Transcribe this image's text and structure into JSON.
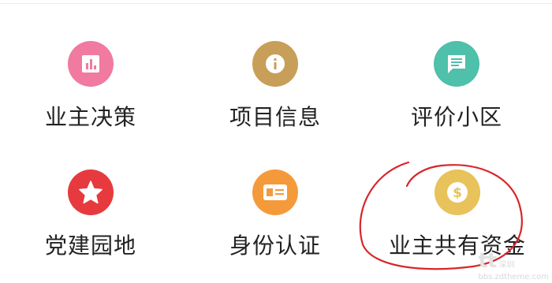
{
  "tiles": [
    {
      "label": "业主决策",
      "icon": "bar-chart-icon",
      "color": "#f07aa0"
    },
    {
      "label": "项目信息",
      "icon": "info-icon",
      "color": "#c79f59"
    },
    {
      "label": "评价小区",
      "icon": "chat-bubble-icon",
      "color": "#4fc0aa"
    },
    {
      "label": "党建园地",
      "icon": "star-icon",
      "color": "#e73a3f"
    },
    {
      "label": "身份认证",
      "icon": "id-card-icon",
      "color": "#f59a3a"
    },
    {
      "label": "业主共有资金",
      "icon": "dollar-coin-icon",
      "color": "#e8c25a"
    }
  ],
  "annotation": {
    "color": "#d8262b"
  },
  "watermark": {
    "logo": "tt",
    "line1": "深圳",
    "line2": "bbs.zdtheme.com"
  }
}
